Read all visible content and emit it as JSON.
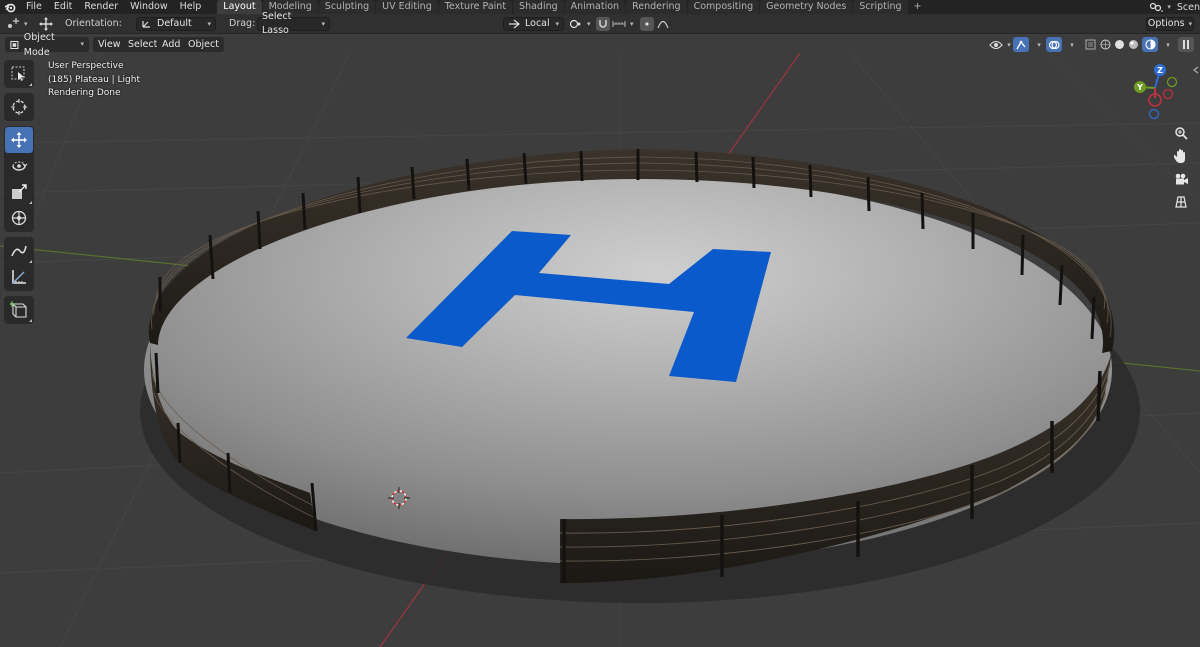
{
  "topbar": {
    "menu": [
      "File",
      "Edit",
      "Render",
      "Window",
      "Help"
    ],
    "workspaces": [
      "Layout",
      "Modeling",
      "Sculpting",
      "UV Editing",
      "Texture Paint",
      "Shading",
      "Animation",
      "Rendering",
      "Compositing",
      "Geometry Nodes",
      "Scripting"
    ],
    "active_workspace": "Layout",
    "add_tab": "+",
    "scene_label": "Scen"
  },
  "toolheader": {
    "orientation_label": "Orientation:",
    "orientation_value": "Default",
    "drag_label": "Drag:",
    "drag_value": "Select Lasso",
    "pivot_value": "Local",
    "options_label": "Options"
  },
  "viewheader": {
    "mode": "Object Mode",
    "menus": [
      "View",
      "Select",
      "Add",
      "Object"
    ]
  },
  "viewport": {
    "line1": "User Perspective",
    "line2": "(185) Plateau | Light",
    "line3": "Rendering Done"
  },
  "gizmo": {
    "x": "X",
    "y": "Y",
    "z": "Z"
  },
  "icons": {
    "toolbar": [
      "select-box-icon",
      "cursor-icon",
      "move-icon",
      "rotate-icon",
      "scale-icon",
      "transform-icon",
      "annotate-icon",
      "measure-icon",
      "add-cube-icon"
    ],
    "nav": [
      "zoom-icon",
      "hand-pan-icon",
      "camera-icon",
      "grid-icon"
    ]
  },
  "colors": {
    "accent": "#4772b3",
    "helipad_mark": "#0a5acb",
    "axis_x": "#c0313f",
    "axis_y": "#6f9b23",
    "axis_z": "#2f6cd6"
  }
}
